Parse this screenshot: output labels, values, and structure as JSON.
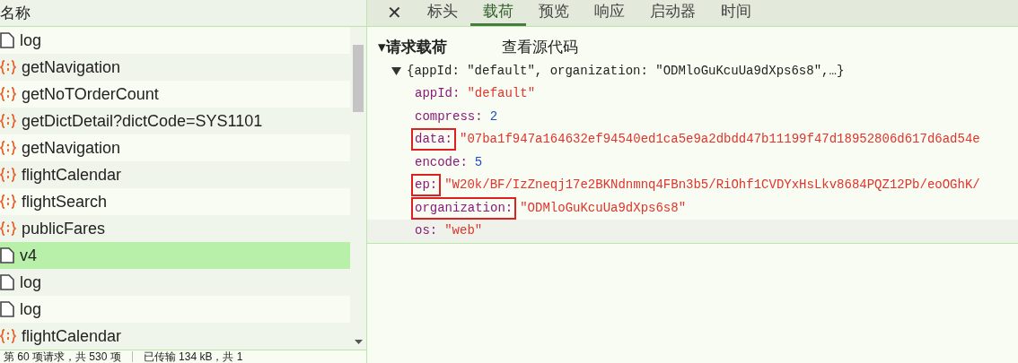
{
  "request_list": {
    "column_header": "名称",
    "rows": [
      {
        "name": "log",
        "kind": "document",
        "selected": false
      },
      {
        "name": "getNavigation",
        "kind": "script",
        "selected": false
      },
      {
        "name": "getNoTOrderCount",
        "kind": "script",
        "selected": false
      },
      {
        "name": "getDictDetail?dictCode=SYS1101",
        "kind": "script",
        "selected": false
      },
      {
        "name": "getNavigation",
        "kind": "script",
        "selected": false
      },
      {
        "name": "flightCalendar",
        "kind": "script",
        "selected": false
      },
      {
        "name": "flightSearch",
        "kind": "script",
        "selected": false
      },
      {
        "name": "publicFares",
        "kind": "script",
        "selected": false
      },
      {
        "name": "v4",
        "kind": "document",
        "selected": true
      },
      {
        "name": "log",
        "kind": "document",
        "selected": false
      },
      {
        "name": "log",
        "kind": "document",
        "selected": false
      },
      {
        "name": "flightCalendar",
        "kind": "script",
        "selected": false
      }
    ]
  },
  "status_bar": [
    "第 60 项请求，共 530 项",
    "已传输 134 kB，共 1"
  ],
  "close": "✕",
  "tabs": [
    {
      "label": "标头",
      "selected": false
    },
    {
      "label": "载荷",
      "selected": true
    },
    {
      "label": "预览",
      "selected": false
    },
    {
      "label": "响应",
      "selected": false
    },
    {
      "label": "启动器",
      "selected": false
    },
    {
      "label": "时间",
      "selected": false
    }
  ],
  "payload": {
    "section_toggle": "▾",
    "section_title": "请求载荷",
    "view_source": "查看源代码",
    "summary": "{appId: \"default\", organization: \"ODMloGuKcuUa9dXps6s8\",…}",
    "fields": [
      {
        "key": "appId:",
        "value": "\"default\"",
        "kind": "string",
        "boxed": false
      },
      {
        "key": "compress:",
        "value": "2",
        "kind": "number",
        "boxed": false
      },
      {
        "key": "data:",
        "value": "\"07ba1f947a164632ef94540ed1ca5e9a2dbdd47b11199f47d18952806d617d6ad54e",
        "kind": "string",
        "boxed": true
      },
      {
        "key": "encode:",
        "value": "5",
        "kind": "number",
        "boxed": false
      },
      {
        "key": "ep:",
        "value": "\"W20k/BF/IzZneqj17e2BKNdnmnq4FBn3b5/RiOhf1CVDYxHsLkv8684PQZ12Pb/eoOGhK/",
        "kind": "string",
        "boxed": true
      },
      {
        "key": "organization:",
        "value": "\"ODMloGuKcuUa9dXps6s8\"",
        "kind": "string",
        "boxed": true
      },
      {
        "key": "os:",
        "value": "\"web\"",
        "kind": "string",
        "boxed": false
      }
    ]
  }
}
